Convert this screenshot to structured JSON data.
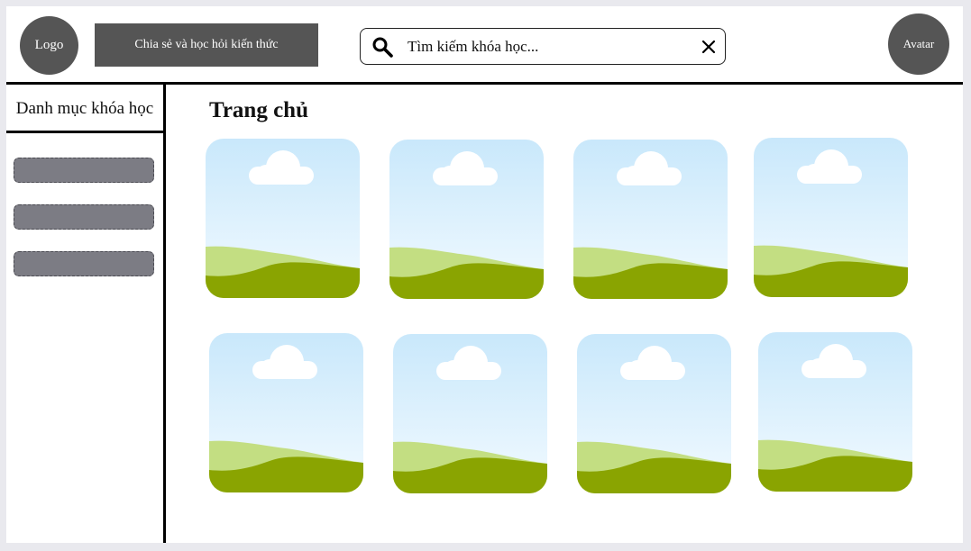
{
  "header": {
    "logo_label": "Logo",
    "tagline": "Chia sẻ và học hỏi kiến thức",
    "search": {
      "placeholder": "Tìm kiếm khóa học...",
      "value": ""
    },
    "avatar_label": "Avatar"
  },
  "sidebar": {
    "title": "Danh mục khóa học",
    "items": [
      "",
      "",
      ""
    ]
  },
  "main": {
    "title": "Trang chủ",
    "cards": [
      {
        "icon": "image-placeholder-icon"
      },
      {
        "icon": "image-placeholder-icon"
      },
      {
        "icon": "image-placeholder-icon"
      },
      {
        "icon": "image-placeholder-icon"
      },
      {
        "icon": "image-placeholder-icon"
      },
      {
        "icon": "image-placeholder-icon"
      },
      {
        "icon": "image-placeholder-icon"
      },
      {
        "icon": "image-placeholder-icon"
      }
    ]
  },
  "colors": {
    "dark_block": "#555555",
    "sidebar_item": "#7c7c84",
    "sky_top": "#c9e8fb",
    "sky_bottom": "#f2faff",
    "hill_light": "#c3de82",
    "hill_dark": "#8aa401",
    "cloud": "#ffffff"
  }
}
